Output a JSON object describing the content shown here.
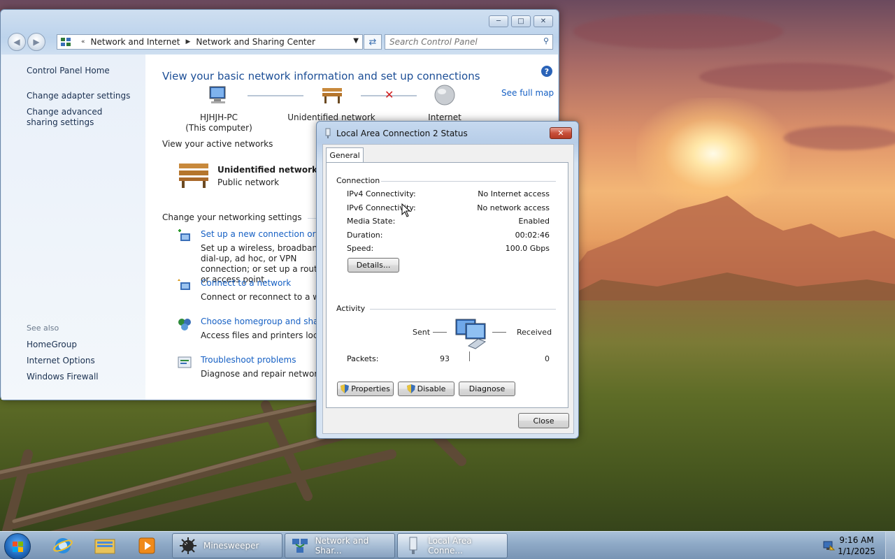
{
  "control_panel": {
    "breadcrumb": [
      "Network and Internet",
      "Network and Sharing Center"
    ],
    "search_placeholder": "Search Control Panel",
    "sidebar": {
      "home": "Control Panel Home",
      "links": [
        "Change adapter settings",
        "Change advanced sharing settings"
      ],
      "see_also_heading": "See also",
      "see_also": [
        "HomeGroup",
        "Internet Options",
        "Windows Firewall"
      ]
    },
    "title": "View your basic network information and set up connections",
    "see_full_map": "See full map",
    "map": {
      "computer_name": "HJHJH-PC",
      "computer_sub": "(This computer)",
      "network": "Unidentified network",
      "internet": "Internet"
    },
    "active_networks_heading": "View your active networks",
    "active_network": {
      "name": "Unidentified network",
      "type": "Public network"
    },
    "change_settings_heading": "Change your networking settings",
    "tasks": [
      {
        "link": "Set up a new connection or network",
        "desc": "Set up a wireless, broadband, dial-up, ad hoc, or VPN connection; or set up a router or access point."
      },
      {
        "link": "Connect to a network",
        "desc": "Connect or reconnect to a wireless, wired, dial-up, or VPN network connection."
      },
      {
        "link": "Choose homegroup and sharing options",
        "desc": "Access files and printers located on other network computers, or change sharing settings."
      },
      {
        "link": "Troubleshoot problems",
        "desc": "Diagnose and repair network problems, or get troubleshooting information."
      }
    ]
  },
  "status_dialog": {
    "title": "Local Area Connection 2 Status",
    "tab": "General",
    "connection_heading": "Connection",
    "rows": [
      {
        "key": "IPv4 Connectivity:",
        "value": "No Internet access"
      },
      {
        "key": "IPv6 Connectivity:",
        "value": "No network access"
      },
      {
        "key": "Media State:",
        "value": "Enabled"
      },
      {
        "key": "Duration:",
        "value": "00:02:46"
      },
      {
        "key": "Speed:",
        "value": "100.0 Gbps"
      }
    ],
    "details_button": "Details...",
    "activity_heading": "Activity",
    "sent_label": "Sent",
    "received_label": "Received",
    "packets_label": "Packets:",
    "packets_sent": "93",
    "packets_received": "0",
    "properties_button": "Properties",
    "disable_button": "Disable",
    "diagnose_button": "Diagnose",
    "close_button": "Close"
  },
  "taskbar": {
    "buttons": [
      {
        "label": "Minesweeper"
      },
      {
        "label": "Network and Shar..."
      },
      {
        "label": "Local Area Conne..."
      }
    ],
    "time": "9:16 AM",
    "date": "1/1/2025"
  }
}
